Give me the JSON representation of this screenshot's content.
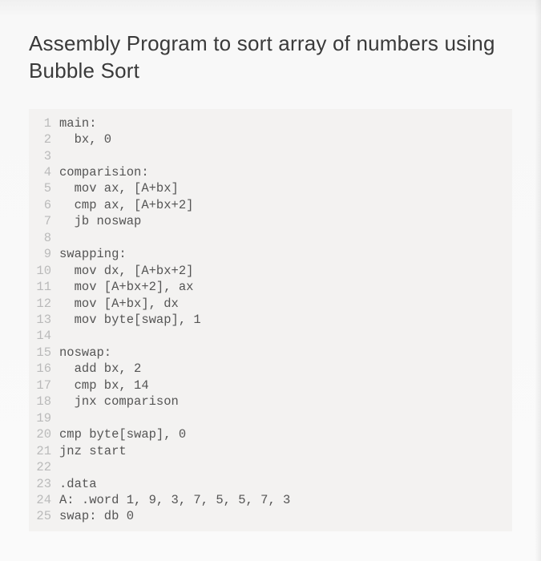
{
  "title": "Assembly Program to sort array of numbers using Bubble Sort",
  "code_lines": [
    {
      "n": "1",
      "c": "main:"
    },
    {
      "n": "2",
      "c": "  bx, 0"
    },
    {
      "n": "3",
      "c": ""
    },
    {
      "n": "4",
      "c": "comparision:"
    },
    {
      "n": "5",
      "c": "  mov ax, [A+bx]"
    },
    {
      "n": "6",
      "c": "  cmp ax, [A+bx+2]"
    },
    {
      "n": "7",
      "c": "  jb noswap"
    },
    {
      "n": "8",
      "c": ""
    },
    {
      "n": "9",
      "c": "swapping:"
    },
    {
      "n": "10",
      "c": "  mov dx, [A+bx+2]"
    },
    {
      "n": "11",
      "c": "  mov [A+bx+2], ax"
    },
    {
      "n": "12",
      "c": "  mov [A+bx], dx"
    },
    {
      "n": "13",
      "c": "  mov byte[swap], 1"
    },
    {
      "n": "14",
      "c": ""
    },
    {
      "n": "15",
      "c": "noswap:"
    },
    {
      "n": "16",
      "c": "  add bx, 2"
    },
    {
      "n": "17",
      "c": "  cmp bx, 14"
    },
    {
      "n": "18",
      "c": "  jnx comparison"
    },
    {
      "n": "19",
      "c": ""
    },
    {
      "n": "20",
      "c": "cmp byte[swap], 0"
    },
    {
      "n": "21",
      "c": "jnz start"
    },
    {
      "n": "22",
      "c": ""
    },
    {
      "n": "23",
      "c": ".data"
    },
    {
      "n": "24",
      "c": "A: .word 1, 9, 3, 7, 5, 5, 7, 3"
    },
    {
      "n": "25",
      "c": "swap: db 0"
    }
  ]
}
